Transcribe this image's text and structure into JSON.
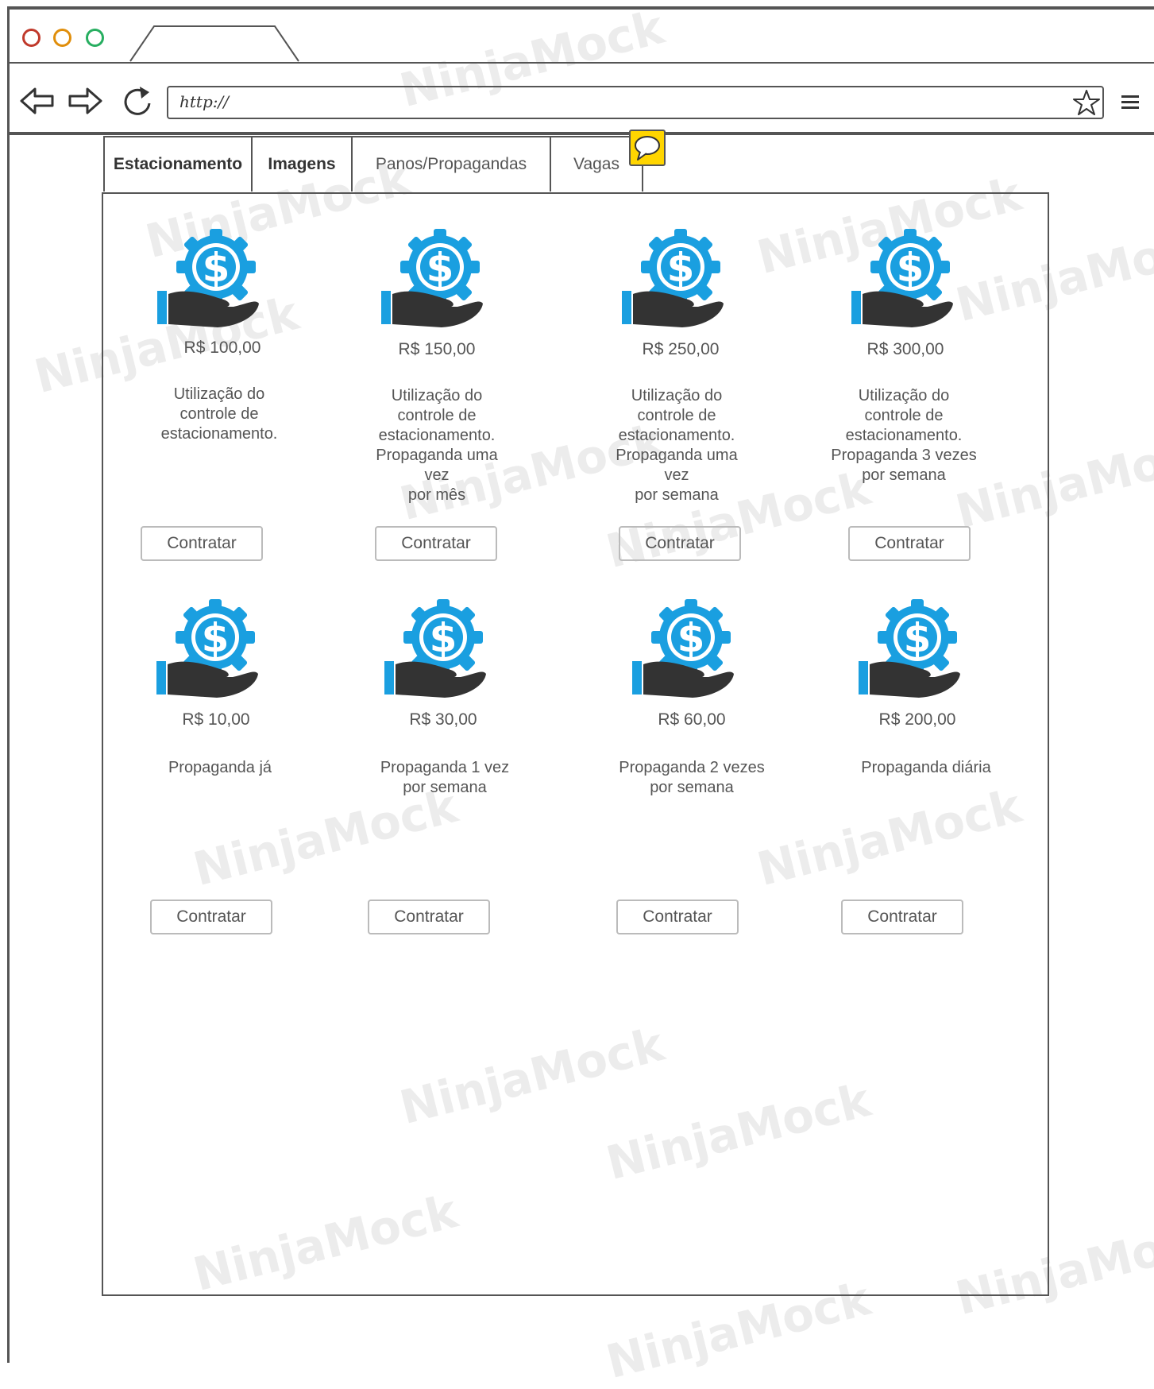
{
  "window": {
    "url": "http://",
    "traffic_lights": {
      "close": "#c0392b",
      "minimize": "#e08e0b",
      "maximize": "#27ae60"
    }
  },
  "watermark": {
    "text": "NinjaMock"
  },
  "tabs": [
    {
      "label": "Estacionamento",
      "bold": true
    },
    {
      "label": "Imagens",
      "bold": true
    },
    {
      "label": "Panos/Propagandas",
      "bold": false
    },
    {
      "label": "Vagas",
      "bold": false
    }
  ],
  "icons": {
    "gear_color": "#1a9fe0",
    "hand_color": "#333333",
    "cuff_color": "#1a9fe0"
  },
  "plans_row1": [
    {
      "price": "R$ 100,00",
      "description": "Utilização do\ncontrole de\nestacionamento.",
      "button": "Contratar"
    },
    {
      "price": "R$ 150,00",
      "description": "Utilização do\ncontrole de\nestacionamento.\nPropaganda uma\nvez\npor  mês",
      "button": "Contratar"
    },
    {
      "price": "R$ 250,00",
      "description": "Utilização do\ncontrole de\nestacionamento.\nPropaganda uma\nvez\npor  semana",
      "button": "Contratar"
    },
    {
      "price": "R$ 300,00",
      "description": "Utilização do\ncontrole de\nestacionamento.\nPropaganda 3 vezes\npor  semana",
      "button": "Contratar"
    }
  ],
  "plans_row2": [
    {
      "price": "R$ 10,00",
      "description": "Propaganda já",
      "button": "Contratar"
    },
    {
      "price": "R$ 30,00",
      "description": "Propaganda 1 vez\npor semana",
      "button": "Contratar"
    },
    {
      "price": "R$ 60,00",
      "description": "Propaganda 2 vezes\npor semana",
      "button": "Contratar"
    },
    {
      "price": "R$ 200,00",
      "description": "Propaganda diária",
      "button": "Contratar"
    }
  ]
}
